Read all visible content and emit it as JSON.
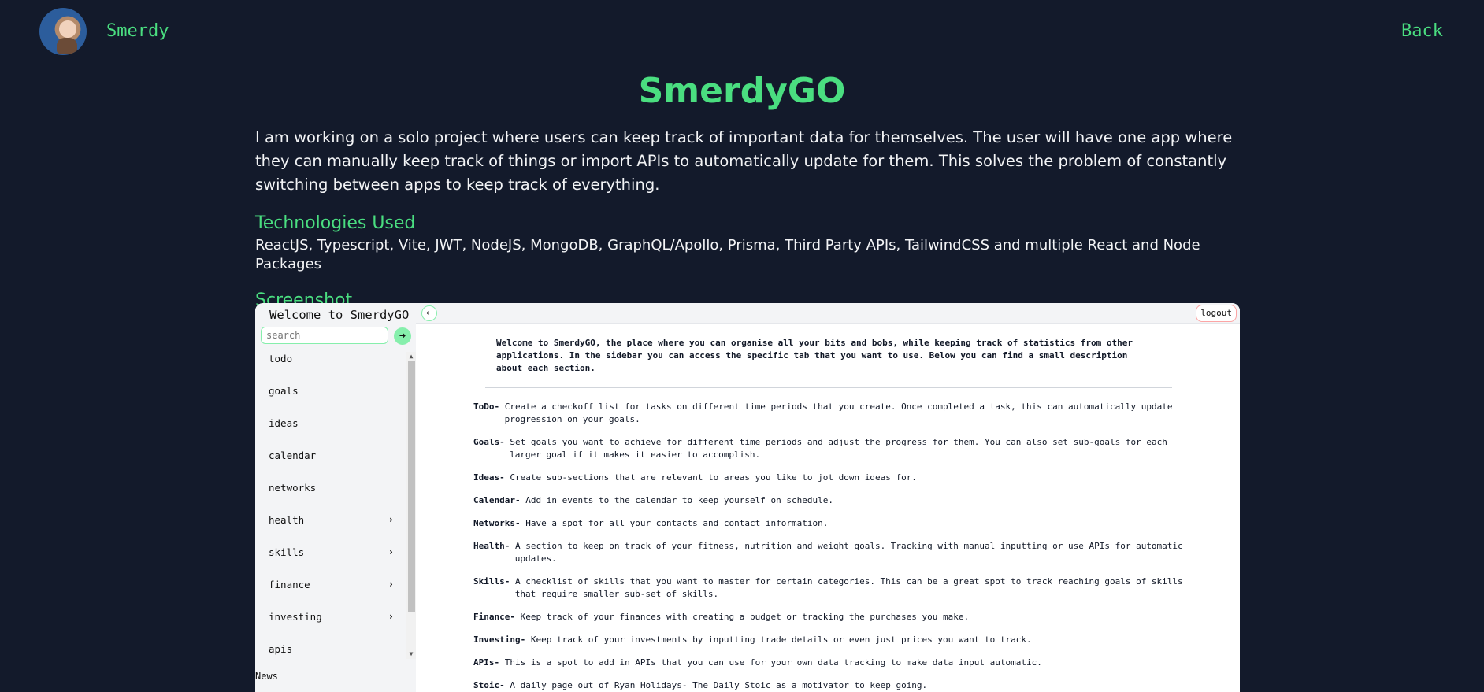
{
  "header": {
    "brand": "Smerdy",
    "back": "Back"
  },
  "page": {
    "title": "SmerdyGO",
    "description": "I am working on a solo project where users can keep track of important data for themselves. The user will have one app where they can manually keep track of things or import APIs to automatically update for them. This solves the problem of constantly switching between apps to keep track of everything.",
    "tech_heading": "Technologies Used",
    "tech_list": "ReactJS, Typescript, Vite, JWT, NodeJS, MongoDB, GraphQL/Apollo, Prisma, Third Party APIs, TailwindCSS and multiple React and Node Packages",
    "screenshot_heading": "Screenshot"
  },
  "app": {
    "sidebar_title": "Welcome to SmerdyGO",
    "search_placeholder": "search",
    "search_go_icon": "arrow-right-icon",
    "nav": [
      {
        "label": "todo",
        "expandable": false
      },
      {
        "label": "goals",
        "expandable": false
      },
      {
        "label": "ideas",
        "expandable": false
      },
      {
        "label": "calendar",
        "expandable": false
      },
      {
        "label": "networks",
        "expandable": false
      },
      {
        "label": "health",
        "expandable": true
      },
      {
        "label": "skills",
        "expandable": true
      },
      {
        "label": "finance",
        "expandable": true
      },
      {
        "label": "investing",
        "expandable": true
      },
      {
        "label": "apis",
        "expandable": false
      }
    ],
    "news": "News",
    "logout": "logout",
    "intro": "Welcome to SmerdyGO, the place where you can organise all your bits and bobs, while keeping track of statistics from other applications. In the sidebar you can access the specific tab that you want to use. Below you can find a small description about each section.",
    "sections": [
      {
        "name": "ToDo-",
        "text": "Create a checkoff list for tasks on different time periods that you create. Once completed a task, this can automatically update progression on your goals."
      },
      {
        "name": "Goals-",
        "text": "Set goals you want to achieve for different time periods and adjust the progress for them. You can also set sub-goals for each larger goal if it makes it easier to accomplish."
      },
      {
        "name": "Ideas-",
        "text": "Create sub-sections that are relevant to areas you like to jot down ideas for."
      },
      {
        "name": "Calendar-",
        "text": "Add in events to the calendar to keep yourself on schedule."
      },
      {
        "name": "Networks-",
        "text": "Have a spot for all your contacts and contact information."
      },
      {
        "name": "Health-",
        "text": "A section to keep on track of your fitness, nutrition and weight goals. Tracking with manual inputting or use APIs for automatic updates."
      },
      {
        "name": "Skills-",
        "text": "A checklist of skills that you want to master for certain categories. This can be a great spot to track reaching goals of skills that require smaller sub-set of skills."
      },
      {
        "name": "Finance-",
        "text": "Keep track of your finances with creating a budget or tracking the purchases you make."
      },
      {
        "name": "Investing-",
        "text": "Keep track of your investments by inputting trade details or even just prices you want to track."
      },
      {
        "name": "APIs-",
        "text": "This is a spot to add in APIs that you can use for your own data tracking to make data input automatic."
      },
      {
        "name": "Stoic-",
        "text": "A daily page out of Ryan Holidays- The Daily Stoic as a motivator to keep going."
      }
    ]
  }
}
